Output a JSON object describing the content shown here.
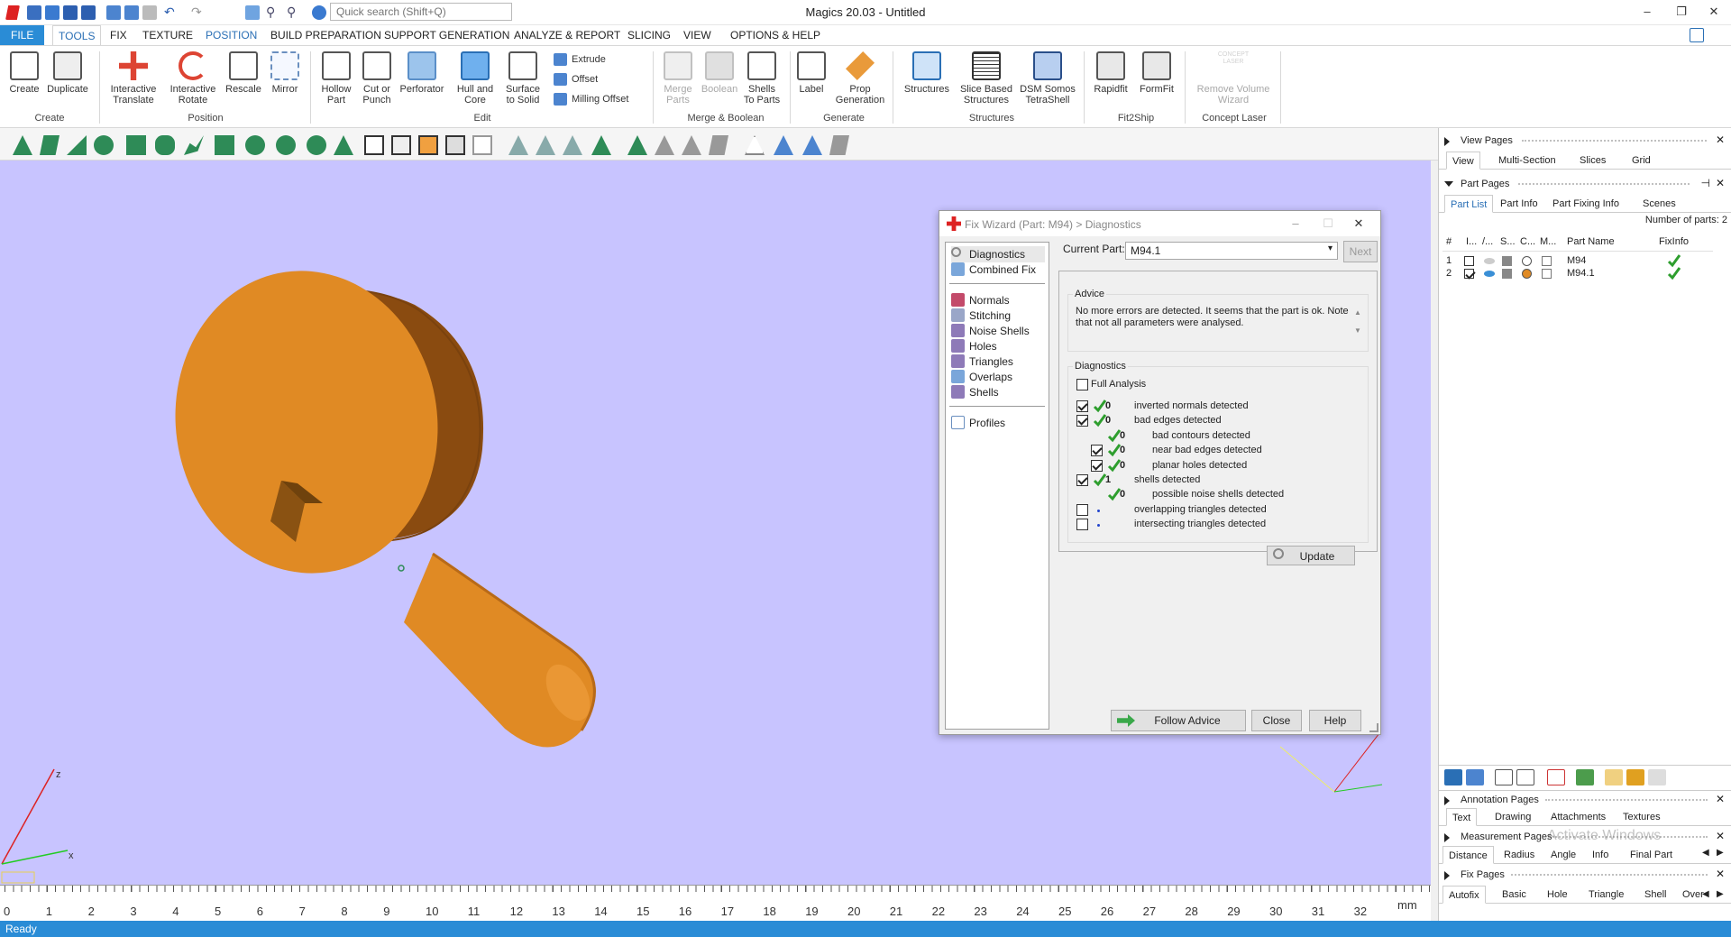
{
  "titlebar": {
    "title": "Magics 20.03 - Untitled",
    "search_placeholder": "Quick search (Shift+Q)",
    "minimize": "‒",
    "restore": "❐",
    "close": "✕"
  },
  "ribbon_tabs": [
    "FILE",
    "TOOLS",
    "FIX",
    "TEXTURE",
    "POSITION",
    "BUILD PREPARATION",
    "SUPPORT GENERATION",
    "ANALYZE & REPORT",
    "SLICING",
    "VIEW",
    "OPTIONS & HELP"
  ],
  "ribbon": {
    "create": {
      "create": "Create",
      "duplicate": "Duplicate",
      "group": "Create"
    },
    "position": {
      "translate": [
        "Interactive",
        "Translate"
      ],
      "rotate": [
        "Interactive",
        "Rotate"
      ],
      "rescale": "Rescale",
      "mirror": "Mirror",
      "group": "Position"
    },
    "edit": {
      "hollow": [
        "Hollow",
        "Part"
      ],
      "cut": [
        "Cut or",
        "Punch"
      ],
      "perforator": "Perforator",
      "hull": [
        "Hull and",
        "Core"
      ],
      "surface": [
        "Surface",
        "to Solid"
      ],
      "extrude": "Extrude",
      "offset": "Offset",
      "milling": "Milling Offset",
      "group": "Edit"
    },
    "merge": {
      "merge": [
        "Merge",
        "Parts"
      ],
      "boolean": "Boolean",
      "shells": [
        "Shells",
        "To Parts"
      ],
      "group": "Merge & Boolean"
    },
    "generate": {
      "label": "Label",
      "prop": [
        "Prop",
        "Generation"
      ],
      "group": "Generate"
    },
    "structures": {
      "structures": "Structures",
      "slice": [
        "Slice Based",
        "Structures"
      ],
      "dsm": [
        "DSM Somos",
        "TetraShell"
      ],
      "group": "Structures"
    },
    "fit2ship": {
      "rapidfit": "Rapidfit",
      "formfit": "FormFit",
      "group": "Fit2Ship"
    },
    "concept": {
      "icon_text": [
        "CONCEPT",
        "LASER"
      ],
      "remove": [
        "Remove Volume",
        "Wizard"
      ],
      "group": "Concept Laser"
    }
  },
  "viewport": {
    "axis_z": "z",
    "axis_x": "x",
    "ruler_unit": "mm",
    "ruler_numbers": [
      "0",
      "1",
      "2",
      "3",
      "4",
      "5",
      "6",
      "7",
      "8",
      "9",
      "10",
      "11",
      "12",
      "13",
      "14",
      "15",
      "16",
      "17",
      "18",
      "19",
      "20",
      "21",
      "22",
      "23",
      "24",
      "25",
      "26",
      "27",
      "28",
      "29",
      "30",
      "31",
      "32"
    ]
  },
  "fix_wizard": {
    "title": "Fix Wizard (Part: M94) > Diagnostics",
    "nav": [
      "Diagnostics",
      "Combined Fix",
      "Normals",
      "Stitching",
      "Noise Shells",
      "Holes",
      "Triangles",
      "Overlaps",
      "Shells",
      "Profiles"
    ],
    "current_part_label": "Current Part:",
    "current_part_value": "M94.1",
    "next": "Next",
    "advice_legend": "Advice",
    "advice_text": "No more errors are detected. It seems that the part is ok. Note that not all parameters were analysed.",
    "diagnostics_legend": "Diagnostics",
    "full_analysis": "Full Analysis",
    "rows": [
      {
        "count": "0",
        "text": "inverted normals detected"
      },
      {
        "count": "0",
        "text": "bad edges detected"
      },
      {
        "count": "0",
        "text": "bad contours detected"
      },
      {
        "count": "0",
        "text": "near bad edges detected"
      },
      {
        "count": "0",
        "text": "planar holes detected"
      },
      {
        "count": "1",
        "text": "shells detected"
      },
      {
        "count": "0",
        "text": "possible noise shells detected"
      },
      {
        "count": "",
        "text": "overlapping triangles detected"
      },
      {
        "count": "",
        "text": "intersecting triangles detected"
      }
    ],
    "update": "Update",
    "follow_advice": "Follow Advice",
    "close": "Close",
    "help": "Help"
  },
  "right_panel": {
    "view_pages": "View Pages",
    "view_tabs": [
      "View",
      "Multi-Section",
      "Slices",
      "Grid"
    ],
    "part_pages": "Part Pages",
    "part_tabs": [
      "Part List",
      "Part Info",
      "Part Fixing Info",
      "Scenes"
    ],
    "num_parts": "Number of parts: 2",
    "columns": [
      "#",
      "I...",
      "/...",
      "S...",
      "C...",
      "M...",
      "Part Name",
      "FixInfo"
    ],
    "parts": [
      {
        "num": "1",
        "name": "M94"
      },
      {
        "num": "2",
        "name": "M94.1"
      }
    ],
    "annotation_pages": "Annotation Pages",
    "annotation_tabs": [
      "Text",
      "Drawing",
      "Attachments",
      "Textures"
    ],
    "measurement_pages": "Measurement Pages",
    "measurement_tabs": [
      "Distance",
      "Radius",
      "Angle",
      "Info",
      "Final Part"
    ],
    "watermark": "Activate Windows",
    "fix_pages": "Fix Pages",
    "fix_tabs": [
      "Autofix",
      "Basic",
      "Hole",
      "Triangle",
      "Shell",
      "Over"
    ]
  },
  "status": "Ready",
  "colors": {
    "accent": "#2a8cd6",
    "viewport_bg": "#c8c4ff",
    "part": "#e08a24",
    "check": "#2e9e2e"
  }
}
